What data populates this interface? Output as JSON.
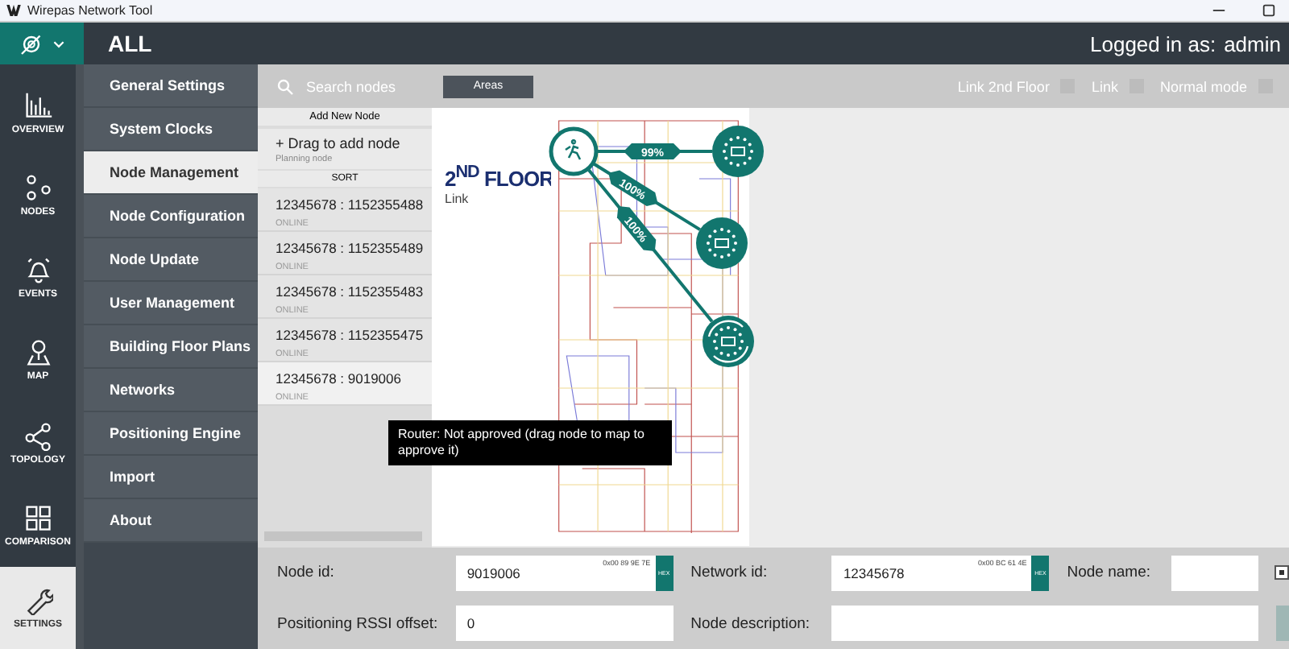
{
  "window": {
    "title": "Wirepas Network Tool"
  },
  "header": {
    "scope": "ALL",
    "login_label": "Logged in as:",
    "user": "admin"
  },
  "rail": [
    {
      "label": "OVERVIEW",
      "kind": "overview",
      "selected": false
    },
    {
      "label": "NODES",
      "kind": "nodes",
      "selected": false
    },
    {
      "label": "EVENTS",
      "kind": "events",
      "selected": false
    },
    {
      "label": "MAP",
      "kind": "map",
      "selected": false
    },
    {
      "label": "TOPOLOGY",
      "kind": "topology",
      "selected": false
    },
    {
      "label": "COMPARISON",
      "kind": "comparison",
      "selected": false
    },
    {
      "label": "SETTINGS",
      "kind": "settings",
      "selected": true
    }
  ],
  "settings_menu": [
    {
      "label": "General Settings",
      "selected": false
    },
    {
      "label": "System Clocks",
      "selected": false
    },
    {
      "label": "Node Management",
      "selected": true
    },
    {
      "label": "Node Configuration",
      "selected": false
    },
    {
      "label": "Node Update",
      "selected": false
    },
    {
      "label": "User Management",
      "selected": false
    },
    {
      "label": "Building Floor Plans",
      "selected": false
    },
    {
      "label": "Networks",
      "selected": false
    },
    {
      "label": "Positioning Engine",
      "selected": false
    },
    {
      "label": "Import",
      "selected": false
    },
    {
      "label": "About",
      "selected": false
    }
  ],
  "toolbar": {
    "search_placeholder": "Search nodes",
    "areas_button": "Areas",
    "toggles": [
      {
        "label": "Link 2nd Floor",
        "checked": false
      },
      {
        "label": "Link",
        "checked": false
      },
      {
        "label": "Normal mode",
        "checked": false
      }
    ]
  },
  "node_list": {
    "add_header": "Add New Node",
    "add_title": "+ Drag to add node",
    "add_subtitle": "Planning node",
    "sort": "SORT",
    "nodes": [
      {
        "id": "12345678 : 1152355488",
        "status": "ONLINE",
        "selected": false
      },
      {
        "id": "12345678 : 1152355489",
        "status": "ONLINE",
        "selected": false
      },
      {
        "id": "12345678 : 1152355483",
        "status": "ONLINE",
        "selected": false
      },
      {
        "id": "12345678 : 1152355475",
        "status": "ONLINE",
        "selected": false
      },
      {
        "id": "12345678 : 9019006",
        "status": "ONLINE",
        "selected": true
      }
    ]
  },
  "map": {
    "floor_title": "2$^{ND}$ FLOOR",
    "floor_subtitle": "Link",
    "nodes": [
      {
        "kind": "router"
      },
      {
        "kind": "sensor"
      },
      {
        "kind": "sensor"
      },
      {
        "kind": "pending"
      }
    ],
    "links": [
      {
        "label": "99%"
      },
      {
        "label": "100%"
      },
      {
        "label": "100%"
      }
    ],
    "tooltip": "Router: Not approved (drag node to map to approve it)"
  },
  "form": {
    "node_id_label": "Node id:",
    "node_id": "9019006",
    "node_id_hex": "0x00 89 9E 7E",
    "hex_button": "HEX",
    "network_id_label": "Network id:",
    "network_id": "12345678",
    "network_id_hex": "0x00 BC 61 4E",
    "network_hex_button": "HEX",
    "node_name_label": "Node name:",
    "node_name_checked": true,
    "rssi_label": "Positioning RSSI offset:",
    "rssi": "0",
    "description_label": "Node description:"
  }
}
